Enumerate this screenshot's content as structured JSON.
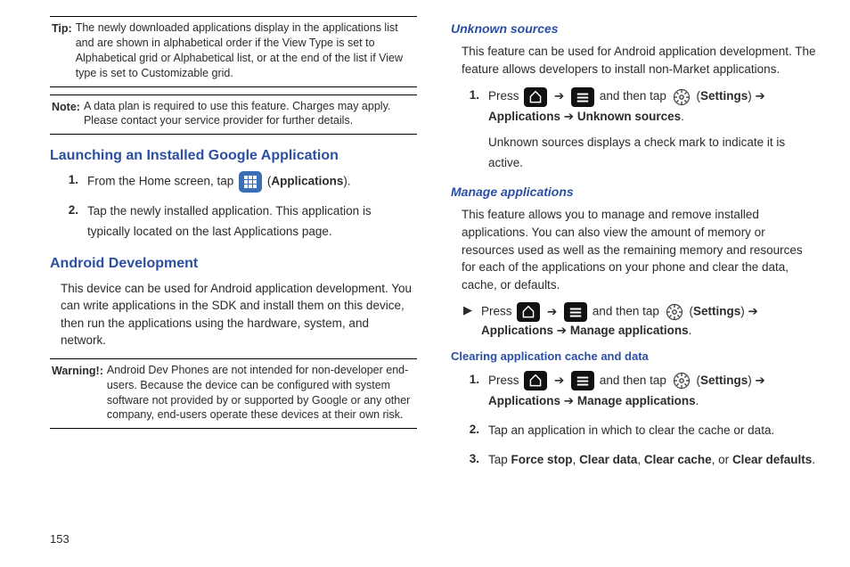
{
  "page_number": "153",
  "left": {
    "tip_label": "Tip:",
    "tip_text": "The newly downloaded applications display in the applications list and are shown in alphabetical order if the View Type is set to Alphabetical grid or Alphabetical list, or at the end of the list if View type is set to Customizable grid.",
    "note_label": "Note:",
    "note_text": "A data plan is required to use this feature. Charges may apply. Please contact your service provider for further details.",
    "h1": "Launching an Installed Google Application",
    "li1_num": "1.",
    "li1_a": "From the Home screen, tap ",
    "li1_b": " (",
    "li1_apps": "Applications",
    "li1_c": ").",
    "li2_num": "2.",
    "li2": "Tap the newly installed application. This application is typically located on the last Applications page.",
    "h2": "Android Development",
    "p1": "This device can be used for Android application development. You can write applications in the SDK and install them on this device, then run the applications using the hardware, system, and network.",
    "warn_label": "Warning!:",
    "warn_text": "Android Dev Phones are not intended for non-developer end-users. Because the device can be configured with system software not provided by or supported by Google or any other company, end-users operate these devices at their own risk."
  },
  "right": {
    "h1": "Unknown sources",
    "p1": "This feature can be used for Android application development. The feature allows developers to install non-Market applications.",
    "s1_num": "1.",
    "press": "Press ",
    "arrow": "➔",
    "andthen": " and then tap ",
    "open_paren": " (",
    "settings": "Settings",
    "close_arrow": ") ➔ ",
    "applications": "Applications",
    "breadcrumb_arrow": "  ➔  ",
    "unknown_sources": "Unknown sources",
    "period": ".",
    "s1_tail": "Unknown sources displays a check mark to indicate it is active.",
    "h2": "Manage applications",
    "p2": "This feature allows you to manage and remove installed applications. You can also view the amount of memory or resources used as well as the remaining memory and resources for each of the applications on your phone and clear the data, cache, or defaults.",
    "manage_apps": "Manage applications",
    "h3": "Clearing application cache and data",
    "c1_num": "1.",
    "c2_num": "2.",
    "c2": "Tap an application in which to clear the cache or data.",
    "c3_num": "3.",
    "c3_a": "Tap ",
    "force_stop": "Force stop",
    "sep": ", ",
    "clear_data": "Clear data",
    "clear_cache": "Clear cache",
    "or": ", or ",
    "clear_defaults": "Clear defaults",
    "tri": "▶"
  }
}
